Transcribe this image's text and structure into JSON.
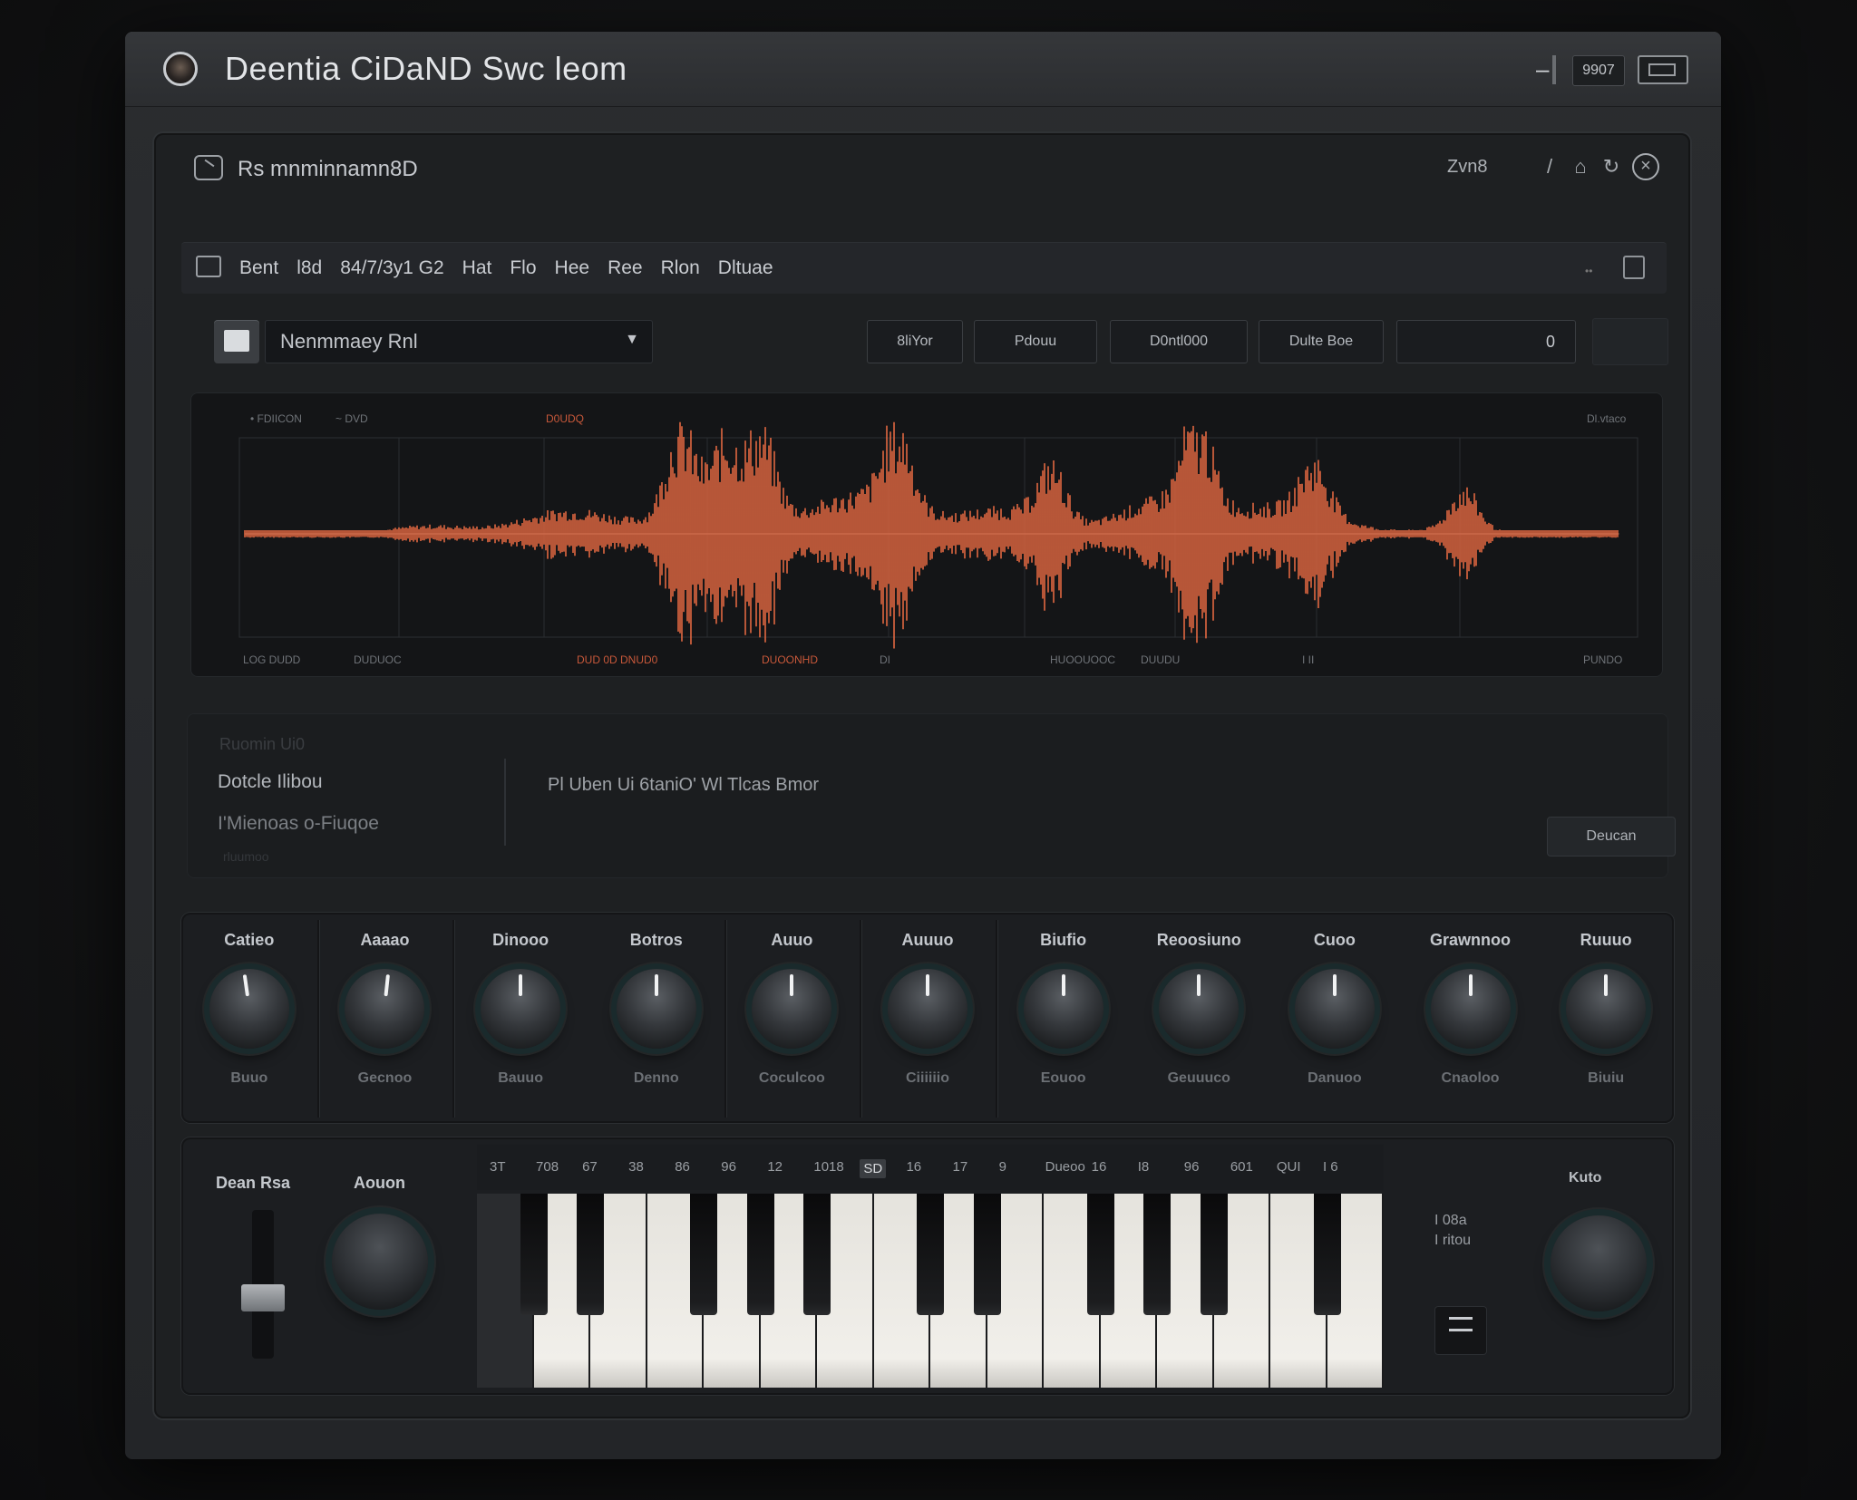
{
  "window": {
    "title": "Deentia CiDaND Swc leom",
    "max_label": "9907"
  },
  "panel": {
    "title": "Rs mnminnamn8D",
    "zoom_label": "Zvn8",
    "icons": [
      "pen-icon",
      "lock-icon",
      "refresh-icon",
      "close-icon"
    ]
  },
  "menu": {
    "items": [
      "Bent",
      "l8d",
      "84/7/3y1 G2",
      "Hat",
      "Flo",
      "Hee",
      "Ree",
      "Rlon",
      "Dltuae"
    ]
  },
  "toolbar": {
    "preset_name": "Nenmmaey Rnl",
    "buttons": [
      "8liYor",
      "Pdouu",
      "D0ntl000",
      "Dulte Boe"
    ],
    "value": "0"
  },
  "waveform": {
    "color": "#f26f45",
    "top_labels": [
      "• FDIICON",
      "~ DVD",
      "D0UDQ",
      "Dl.vtaco"
    ],
    "bottom_labels": [
      "LOG DUDD",
      "DUDUOC",
      "DUD 0D DNUD0",
      "DUOONHD",
      "DI",
      "HUOOUOOC",
      "DUUDU",
      "I II",
      "PUNDO"
    ]
  },
  "info": {
    "faded_top": "Ruomin Ui0",
    "line1": "Dotcle Ilibou",
    "line2": "I'Mienoas o-Fiuqoe",
    "faded_bottom": "rluumoo",
    "message": "Pl Uben Ui 6taniO' Wl Tlcas Bmor",
    "button_label": "Deucan"
  },
  "knobs": [
    {
      "label": "Catieo",
      "value": "Buuo",
      "angle": -8
    },
    {
      "label": "Aaaao",
      "value": "Gecnoo",
      "angle": 6
    },
    {
      "label": "Dinooo",
      "value": "Bauuo",
      "angle": 0
    },
    {
      "label": "Botros",
      "value": "Denno",
      "angle": 0
    },
    {
      "label": "Auuo",
      "value": "Coculcoo",
      "angle": 0
    },
    {
      "label": "Auuuo",
      "value": "Ciiiiiio",
      "angle": 0
    },
    {
      "label": "Biufio",
      "value": "Eouoo",
      "angle": 0
    },
    {
      "label": "Reoosiuno",
      "value": "Geuuuco",
      "angle": 0
    },
    {
      "label": "Cuoo",
      "value": "Danuoo",
      "angle": 0
    },
    {
      "label": "Grawnnoo",
      "value": "Cnaoloo",
      "angle": 0
    },
    {
      "label": "Ruuuo",
      "value": "Biuiu",
      "angle": 0
    }
  ],
  "keys_section": {
    "fader_label": "Dean Rsa",
    "knob_label": "Aouon",
    "note_labels": [
      "3T",
      "708",
      "67",
      "38",
      "86",
      "96",
      "12",
      "1018",
      "SD",
      "16",
      "17",
      "9",
      "Dueoo",
      "16",
      "I8",
      "96",
      "601",
      "QUI",
      "I 6"
    ],
    "active_note_index": 8,
    "right_label": "Kuto",
    "right_small": [
      "I 08a",
      "I ritou"
    ]
  }
}
